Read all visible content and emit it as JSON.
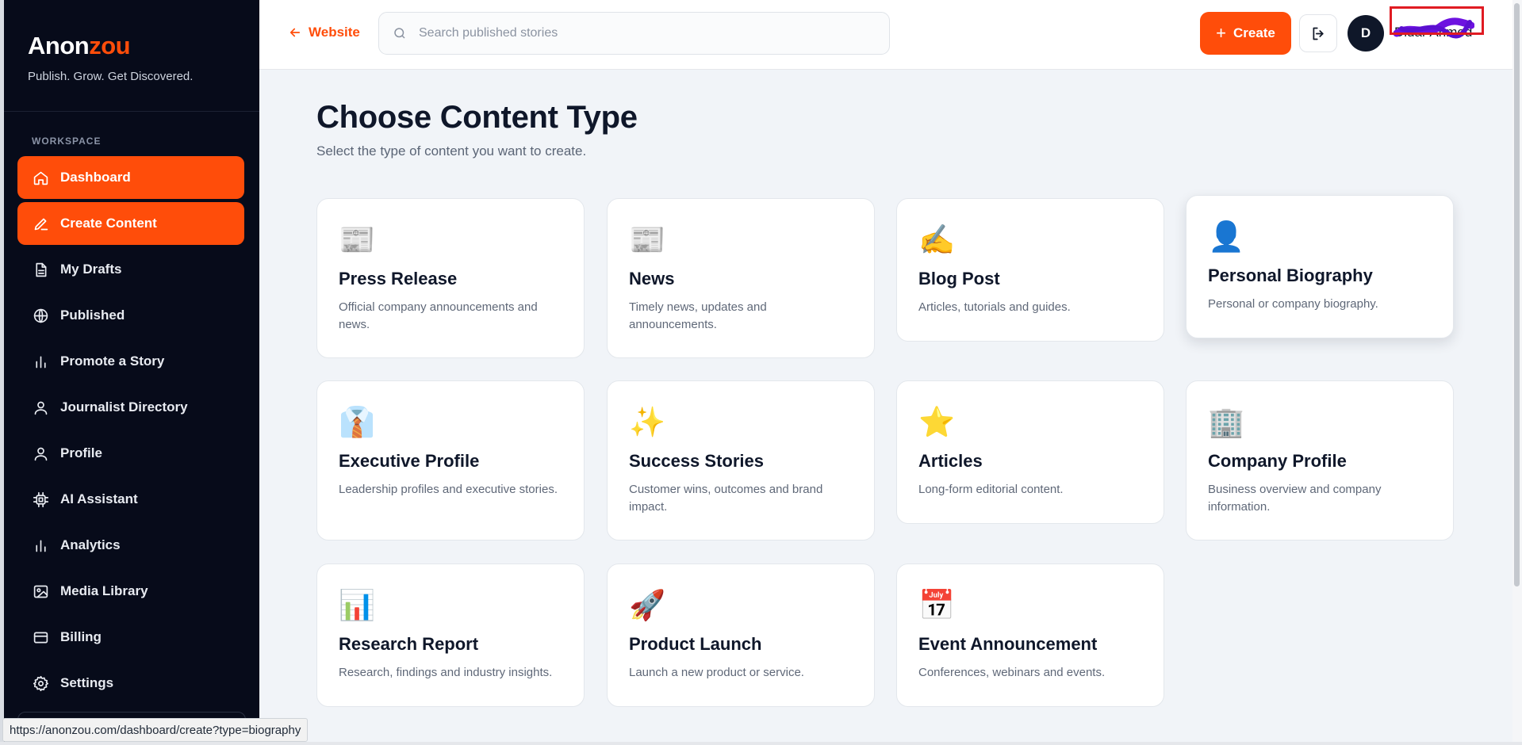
{
  "brand": {
    "name_main": "Anon",
    "name_accent": "zou",
    "tagline": "Publish. Grow. Get Discovered."
  },
  "sidebar": {
    "section_label": "WORKSPACE",
    "items": [
      {
        "label": "Dashboard",
        "icon": "home-icon",
        "active": true
      },
      {
        "label": "Create Content",
        "icon": "pencil-icon",
        "active": true
      },
      {
        "label": "My Drafts",
        "icon": "document-icon",
        "active": false
      },
      {
        "label": "Published",
        "icon": "globe-icon",
        "active": false
      },
      {
        "label": "Promote a Story",
        "icon": "bar-chart-icon",
        "active": false
      },
      {
        "label": "Journalist Directory",
        "icon": "user-icon",
        "active": false
      },
      {
        "label": "Profile",
        "icon": "user-icon",
        "active": false
      },
      {
        "label": "AI Assistant",
        "icon": "chip-icon",
        "active": false
      },
      {
        "label": "Analytics",
        "icon": "bar-chart-icon",
        "active": false
      },
      {
        "label": "Media Library",
        "icon": "image-icon",
        "active": false
      },
      {
        "label": "Billing",
        "icon": "credit-card-icon",
        "active": false
      },
      {
        "label": "Settings",
        "icon": "gear-icon",
        "active": false
      }
    ]
  },
  "header": {
    "back_label": "Website",
    "search_placeholder": "Search published stories",
    "create_label": "Create",
    "avatar_initial": "D",
    "user_name": "Didar Ahmed"
  },
  "main": {
    "title": "Choose Content Type",
    "subtitle": "Select the type of content you want to create.",
    "cards": [
      {
        "title": "Press Release",
        "desc": "Official company announcements and news.",
        "icon": "newspaper-icon"
      },
      {
        "title": "News",
        "desc": "Timely news, updates and announcements.",
        "icon": "newspaper-icon"
      },
      {
        "title": "Blog Post",
        "desc": "Articles, tutorials and guides.",
        "icon": "writing-hand-icon"
      },
      {
        "title": "Personal Biography",
        "desc": "Personal or company biography.",
        "icon": "person-silhouette-icon"
      },
      {
        "title": "Executive Profile",
        "desc": "Leadership profiles and executive stories.",
        "icon": "necktie-icon"
      },
      {
        "title": "Success Stories",
        "desc": "Customer wins, outcomes and brand impact.",
        "icon": "sparkles-icon"
      },
      {
        "title": "Articles",
        "desc": "Long-form editorial content.",
        "icon": "star-icon"
      },
      {
        "title": "Company Profile",
        "desc": "Business overview and company information.",
        "icon": "office-building-icon"
      },
      {
        "title": "Research Report",
        "desc": "Research, findings and industry insights.",
        "icon": "bar-chart-emoji-icon"
      },
      {
        "title": "Product Launch",
        "desc": "Launch a new product or service.",
        "icon": "rocket-icon"
      },
      {
        "title": "Event Announcement",
        "desc": "Conferences, webinars and events.",
        "icon": "calendar-icon"
      }
    ]
  },
  "status_bar": {
    "url": "https://anonzou.com/dashboard/create?type=biography"
  },
  "colors": {
    "accent": "#ff4d0a",
    "sidebar_bg": "#070b1a",
    "page_bg": "#f1f4f8"
  }
}
